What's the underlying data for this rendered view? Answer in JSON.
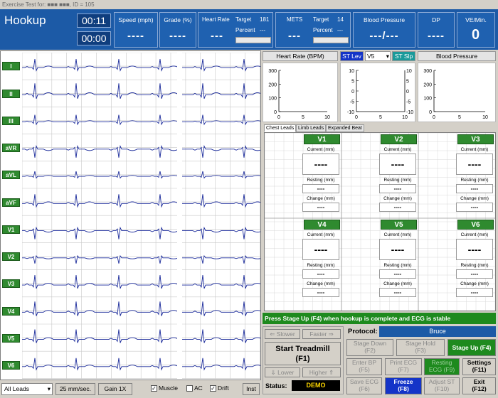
{
  "title_bar": "Exercise Test for: ■■■ ■■■, ID = 105",
  "top": {
    "mode": "Hookup",
    "timer1": "00:11",
    "timer2": "00:00",
    "speed": {
      "label": "Speed (mph)",
      "value": "----"
    },
    "grade": {
      "label": "Grade (%)",
      "value": "----"
    },
    "heart_rate": {
      "label": "Heart Rate",
      "value": "---",
      "target_label": "Target",
      "target_value": "181",
      "percent_label": "Percent",
      "percent_value": "---"
    },
    "mets": {
      "label": "METS",
      "value": "---",
      "target_label": "Target",
      "target_value": "14",
      "percent_label": "Percent",
      "percent_value": "---"
    },
    "bp": {
      "label": "Blood Pressure",
      "value": "---/---"
    },
    "dp": {
      "label": "DP",
      "value": "----"
    },
    "ve": {
      "label": "VE/Min.",
      "value": "0"
    }
  },
  "ecg": {
    "leads": [
      "I",
      "II",
      "III",
      "aVR",
      "aVL",
      "aVF",
      "V1",
      "V2",
      "V3",
      "V4",
      "V5",
      "V6"
    ],
    "controls": {
      "lead_select": "All Leads",
      "speed": "25 mm/sec.",
      "gain": "Gain 1X",
      "muscle": "Muscle",
      "ac": "AC",
      "drift": "Drift",
      "inst": "Inst"
    }
  },
  "mini_charts": {
    "hr_header": "Heart Rate (BPM)",
    "st_lev": "ST Lev",
    "st_lead": "V5",
    "st_slp": "ST Slp",
    "bp_header": "Blood Pressure",
    "hr_y_ticks": [
      "300",
      "200",
      "100",
      "0"
    ],
    "st_left_ticks": [
      "10",
      "5",
      "0",
      "-5",
      "-10"
    ],
    "st_right_ticks": [
      "10",
      "5",
      "0",
      "-5",
      "-10"
    ],
    "x_ticks": [
      "0",
      "5",
      "10"
    ],
    "bp_y_ticks": [
      "300",
      "200",
      "100",
      "0"
    ]
  },
  "tabs": [
    "Chest Leads",
    "Limb Leads",
    "Expanded Beat"
  ],
  "chest_leads": {
    "current_label": "Current (mm)",
    "resting_label": "Resting (mm)",
    "change_label": "Change (mm)",
    "current_value": "----",
    "resting_value": "----",
    "change_value": "----",
    "leads": [
      "V1",
      "V2",
      "V3",
      "V4",
      "V5",
      "V6"
    ]
  },
  "message": "Press Stage Up (F4) when hookup is complete and ECG is stable",
  "treadmill": {
    "slower": "Slower",
    "faster": "Faster",
    "start": "Start Treadmill",
    "start_key": "(F1)",
    "lower": "Lower",
    "higher": "Higher",
    "status_label": "Status:",
    "status_value": "DEMO"
  },
  "protocol": {
    "label": "Protocol:",
    "value": "Bruce"
  },
  "buttons": {
    "stage_down": [
      "Stage Down",
      "(F2)"
    ],
    "stage_hold": [
      "Stage Hold",
      "(F3)"
    ],
    "stage_up": "Stage Up (F4)",
    "enter_bp": [
      "Enter BP",
      "(F5)"
    ],
    "print_ecg": [
      "Print ECG",
      "(F7)"
    ],
    "resting_ecg": [
      "Resting",
      "ECG (F9)"
    ],
    "settings": [
      "Settings",
      "(F11)"
    ],
    "save_ecg": [
      "Save ECG",
      "(F6)"
    ],
    "freeze": [
      "Freeze",
      "(F8)"
    ],
    "adjust_st": [
      "Adjust ST",
      "(F10)"
    ],
    "exit": [
      "Exit",
      "(F12)"
    ]
  },
  "colors": {
    "panel_blue": "#1c5aa6",
    "lead_green": "#2f8a2f",
    "trace_blue": "#1a2a9a",
    "grid": "#c8c8c8"
  }
}
